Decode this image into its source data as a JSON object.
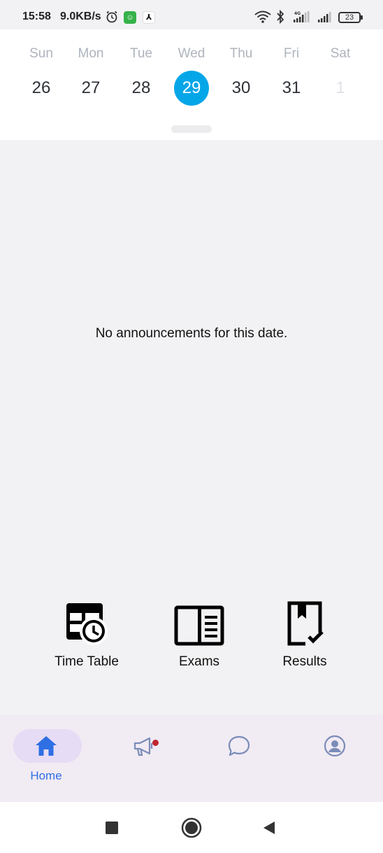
{
  "status_bar": {
    "time": "15:58",
    "network_speed": "9.0KB/s",
    "battery_level": "23",
    "icons": [
      "alarm-icon",
      "app-notification-icon",
      "app-notification-icon",
      "wifi-icon",
      "bluetooth-icon",
      "signal-icon",
      "signal-icon",
      "battery-icon"
    ]
  },
  "calendar": {
    "days": [
      {
        "name": "Sun",
        "date": "26"
      },
      {
        "name": "Mon",
        "date": "27"
      },
      {
        "name": "Tue",
        "date": "28"
      },
      {
        "name": "Wed",
        "date": "29"
      },
      {
        "name": "Thu",
        "date": "30"
      },
      {
        "name": "Fri",
        "date": "31"
      },
      {
        "name": "Sat",
        "date": "1"
      }
    ],
    "selected_date": "29",
    "accent_color": "#05a6e8"
  },
  "announcements": {
    "empty_message": "No announcements for this date."
  },
  "quick_actions": [
    {
      "label": "Time Table",
      "icon": "timetable-clock-icon"
    },
    {
      "label": "Exams",
      "icon": "open-book-icon"
    },
    {
      "label": "Results",
      "icon": "bookmark-check-icon"
    }
  ],
  "bottom_nav": {
    "items": [
      {
        "label": "Home",
        "icon": "home-icon",
        "active": true
      },
      {
        "label": "",
        "icon": "megaphone-icon",
        "active": false,
        "has_badge": true
      },
      {
        "label": "",
        "icon": "chat-icon",
        "active": false
      },
      {
        "label": "",
        "icon": "profile-icon",
        "active": false
      }
    ],
    "active_color": "#2f6fe4",
    "badge_color": "#c0262d"
  },
  "system_nav": {
    "buttons": [
      "recents-button",
      "home-button",
      "back-button"
    ]
  }
}
